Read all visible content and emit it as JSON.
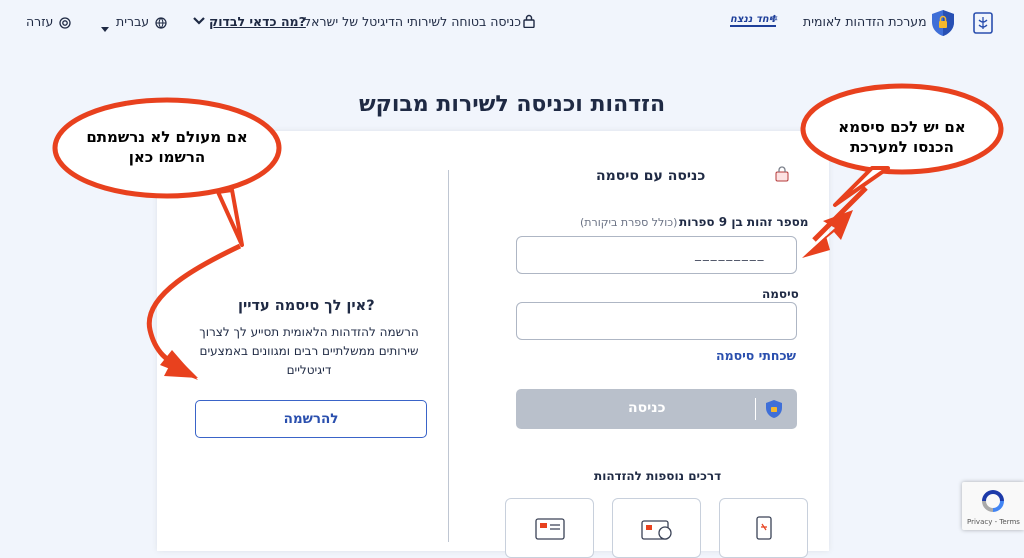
{
  "header": {
    "system_title": "מערכת הזדהות לאומית",
    "yahad_badge": "יחד ננצח!",
    "secure_notice": "כניסה בטוחה לשירותי הדיגיטל של ישראל",
    "why_check_link": "מה כדאי לבדוק?",
    "language": "עברית",
    "help": "עזרה"
  },
  "page": {
    "heading": "הזדהות וכניסה לשירות מבוקש"
  },
  "login": {
    "title": "כניסה עם סיסמה",
    "id_label": "מספר זהות בן 9 ספרות",
    "id_hint": "(כולל ספרת ביקורת)",
    "id_placeholder": "_ _ _ _ _ _ _ _ _",
    "password_label": "סיסמה",
    "password_value": "",
    "forgot_password": "שכחתי סיסמה",
    "submit_label": "כניסה",
    "other_methods_title": "דרכים נוספות להזדהות"
  },
  "signup": {
    "title": "אין לך סיסמה עדיין?",
    "description_line1": "הרשמה להזדהות הלאומית תסייע לך לצרוך",
    "description_line2": "שירותים ממשלתיים רבים ומגוונים באמצעים",
    "description_line3": "דיגיטליים",
    "register_label": "להרשמה"
  },
  "annotations": {
    "right_bubble_line1": "אם יש לכם סיסמא",
    "right_bubble_line2": "הכנסו למערכת",
    "left_bubble_line1": "אם מעולם לא נרשמתם",
    "left_bubble_line2": "הרשמו כאן"
  },
  "recaptcha": {
    "footer": "Privacy - Terms"
  },
  "colors": {
    "accent": "#2a4fae",
    "arrow": "#e8411e",
    "primary_disabled": "#b9c0cb"
  }
}
